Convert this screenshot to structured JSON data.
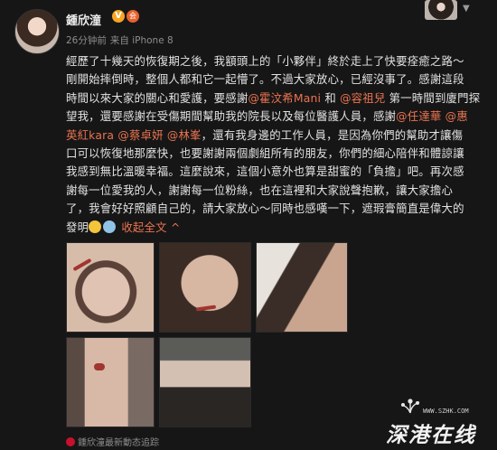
{
  "header": {
    "username": "鍾欣潼",
    "verified_badge": "V",
    "vip_badge": "会",
    "time": "26分钟前",
    "source": "来自 iPhone 8"
  },
  "post": {
    "lines": [
      "經歷了十幾天的恢復期之後，我額頭上的「小夥伴」終於走上了快要痊癒之路～",
      "剛開始摔倒時，整個人都和它一起懵了。不過大家放心，已經沒事了。感謝這段",
      "時間以來大家的關心和愛護，要感謝",
      "望我，還要感謝在受傷期間幫助我的院長以及每位醫護人員，感謝",
      "英紅kara",
      "口可以恢復地那麼快，也要謝謝兩個劇組所有的朋友，你們的細心陪伴和體諒讓",
      "我感到無比溫暖幸福。這麼說來，這個小意外也算是甜蜜的「負擔」吧。再次感",
      "謝每一位愛我的人，謝謝每一位粉絲，也在這裡和大家說聲抱歉，讓大家擔心",
      "了，我會好好照顧自己的，請大家放心～同時也感嘆一下，遮瑕膏簡直是偉大的",
      "發明"
    ],
    "line3_link1": "@霍汶希Mani",
    "line3_and": " 和 ",
    "line3_link2": "@容祖兒",
    "line3_tail": " 第一時間到廈門探",
    "line4_link1": "@任達華",
    "line4_link2": "@惠",
    "line5_sep": " ",
    "line5_link1": "@蔡卓妍",
    "line5_link2": "@林峯",
    "line5_tail": "，還有我身邊的工作人員，是因為你們的幫助才讓傷",
    "collapse": "收起全文",
    "collapse_caret": "^"
  },
  "photos": [
    {
      "name": "photo-forehead-wound"
    },
    {
      "name": "photo-forehead-stitches"
    },
    {
      "name": "photo-face-bandaged"
    },
    {
      "name": "photo-face-bruised"
    },
    {
      "name": "photo-selfie-with-others"
    }
  ],
  "footer": {
    "text": "鍾欣潼最新動态追踪"
  },
  "watermark": {
    "url": "WWW.SZHK.COM",
    "text": "深港在线"
  },
  "colors": {
    "background": "#161616",
    "link": "#eb7350",
    "meta": "#8d8d8d"
  }
}
